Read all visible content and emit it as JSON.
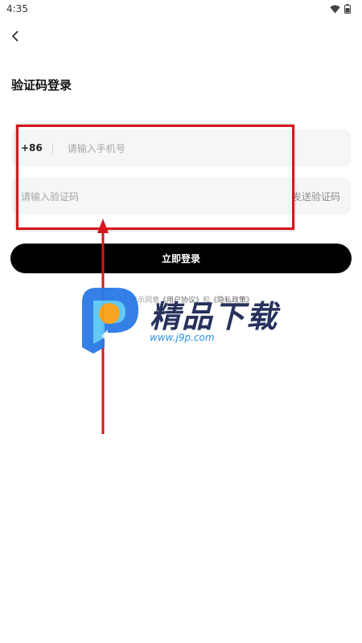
{
  "status_bar": {
    "time": "4:35"
  },
  "header": {
    "title": "验证码登录"
  },
  "phone_field": {
    "country_code": "+86",
    "placeholder": "请输入手机号"
  },
  "code_field": {
    "placeholder": "请输入验证码",
    "send_code_label": "发送验证码"
  },
  "login_button": {
    "label": "立即登录"
  },
  "agreement": {
    "prefix": "登录即表示同意",
    "user_agreement": "《用户协议》",
    "joiner": "和",
    "privacy_policy": "《隐私政策》"
  },
  "watermark": {
    "title": "精品下载",
    "url": "www.j9p.com"
  },
  "colors": {
    "accent": "#000000",
    "annotation": "#d8131b",
    "field_bg": "#f6f6f6"
  }
}
